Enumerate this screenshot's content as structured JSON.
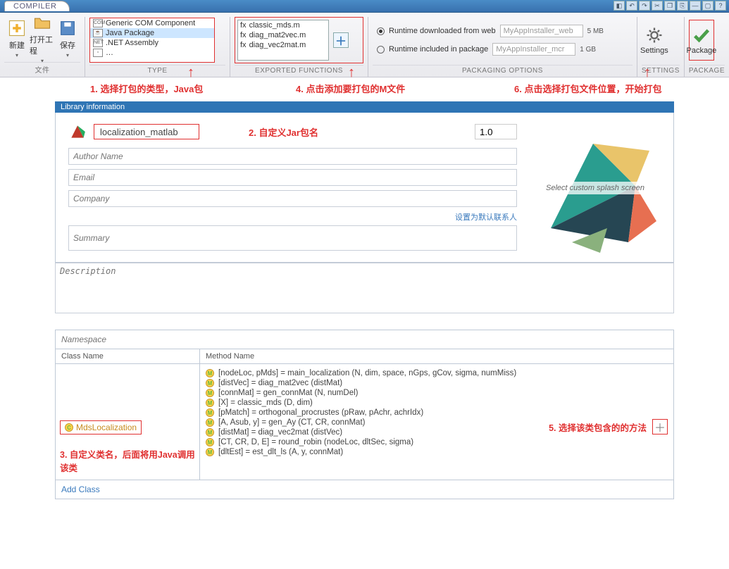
{
  "tab": "COMPILER",
  "ribbon": {
    "file": {
      "label": "文件",
      "new": "新建",
      "open": "打开工程",
      "save": "保存"
    },
    "type": {
      "label": "TYPE",
      "items": [
        "Generic COM Component",
        "Java Package",
        ".NET Assembly"
      ],
      "selected_index": 1
    },
    "exported": {
      "label": "EXPORTED FUNCTIONS",
      "files": [
        "classic_mds.m",
        "diag_mat2vec.m",
        "diag_vec2mat.m"
      ]
    },
    "packaging": {
      "label": "PACKAGING OPTIONS",
      "opt_web": "Runtime downloaded from web",
      "opt_pkg": "Runtime included in package",
      "name_web": "MyAppInstaller_web",
      "name_mcr": "MyAppInstaller_mcr",
      "size_web": "5 MB",
      "size_mcr": "1 GB"
    },
    "settings": {
      "label": "SETTINGS",
      "btn": "Settings"
    },
    "package": {
      "label": "PACKAGE",
      "btn": "Package"
    }
  },
  "annotations": {
    "a1": "1. 选择打包的类型，Java包",
    "a2": "2. 自定义Jar包名",
    "a3": "3. 自定义类名，后面将用Java调用该类",
    "a4": "4. 点击添加要打包的M文件",
    "a5": "5. 选择该类包含的的方法",
    "a6": "6. 点击选择打包文件位置，开始打包"
  },
  "libinfo": {
    "header": "Library information",
    "name": "localization_matlab",
    "version": "1.0",
    "author_ph": "Author Name",
    "email_ph": "Email",
    "company_ph": "Company",
    "set_default": "设置为默认联系人",
    "summary_ph": "Summary",
    "description_ph": "Description",
    "splash": "Select custom splash screen"
  },
  "classes": {
    "namespace_ph": "Namespace",
    "col_class": "Class Name",
    "col_method": "Method Name",
    "class_name": "MdsLocalization",
    "methods": [
      "[nodeLoc, pMds] = main_localization (N, dim, space, nGps, gCov, sigma, numMiss)",
      "[distVec] = diag_mat2vec (distMat)",
      "[connMat] = gen_connMat (N, numDel)",
      "[X] = classic_mds (D, dim)",
      "[pMatch] = orthogonal_procrustes (pRaw, pAchr, achrIdx)",
      "[A, Asub, y] = gen_Ay (CT, CR, connMat)",
      "[distMat] = diag_vec2mat (distVec)",
      "[CT, CR, D, E] = round_robin (nodeLoc, dltSec, sigma)",
      "[dltEst] = est_dlt_ls (A, y, connMat)"
    ],
    "add_class": "Add Class"
  }
}
